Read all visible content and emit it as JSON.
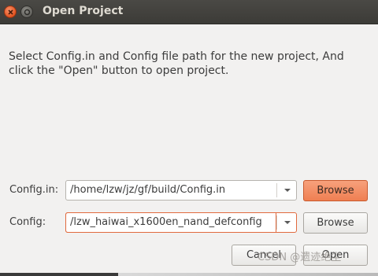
{
  "window": {
    "title": "Open Project"
  },
  "dialog": {
    "message": "Select Config.in and Config file path for the new project, And click the \"Open\" button to open project."
  },
  "config_in": {
    "label": "Config.in:",
    "value": "/home/lzw/jz/gf/build/Config.in",
    "browse_label": "Browse"
  },
  "config": {
    "label": "Config:",
    "value": "/lzw_haiwai_x1600en_nand_defconfig",
    "browse_label": "Browse"
  },
  "buttons": {
    "cancel": "Cancel",
    "open": "Open"
  },
  "watermark": "CSDN @遗迹绝尘",
  "colors": {
    "titlebar": "#3c3b37",
    "accent": "#ef7f52",
    "focus_border": "#e16a3e",
    "background": "#f2f1f0"
  },
  "icons": {
    "close": "close-icon",
    "minimize": "minimize-icon",
    "dropdown": "chevron-down-icon"
  }
}
